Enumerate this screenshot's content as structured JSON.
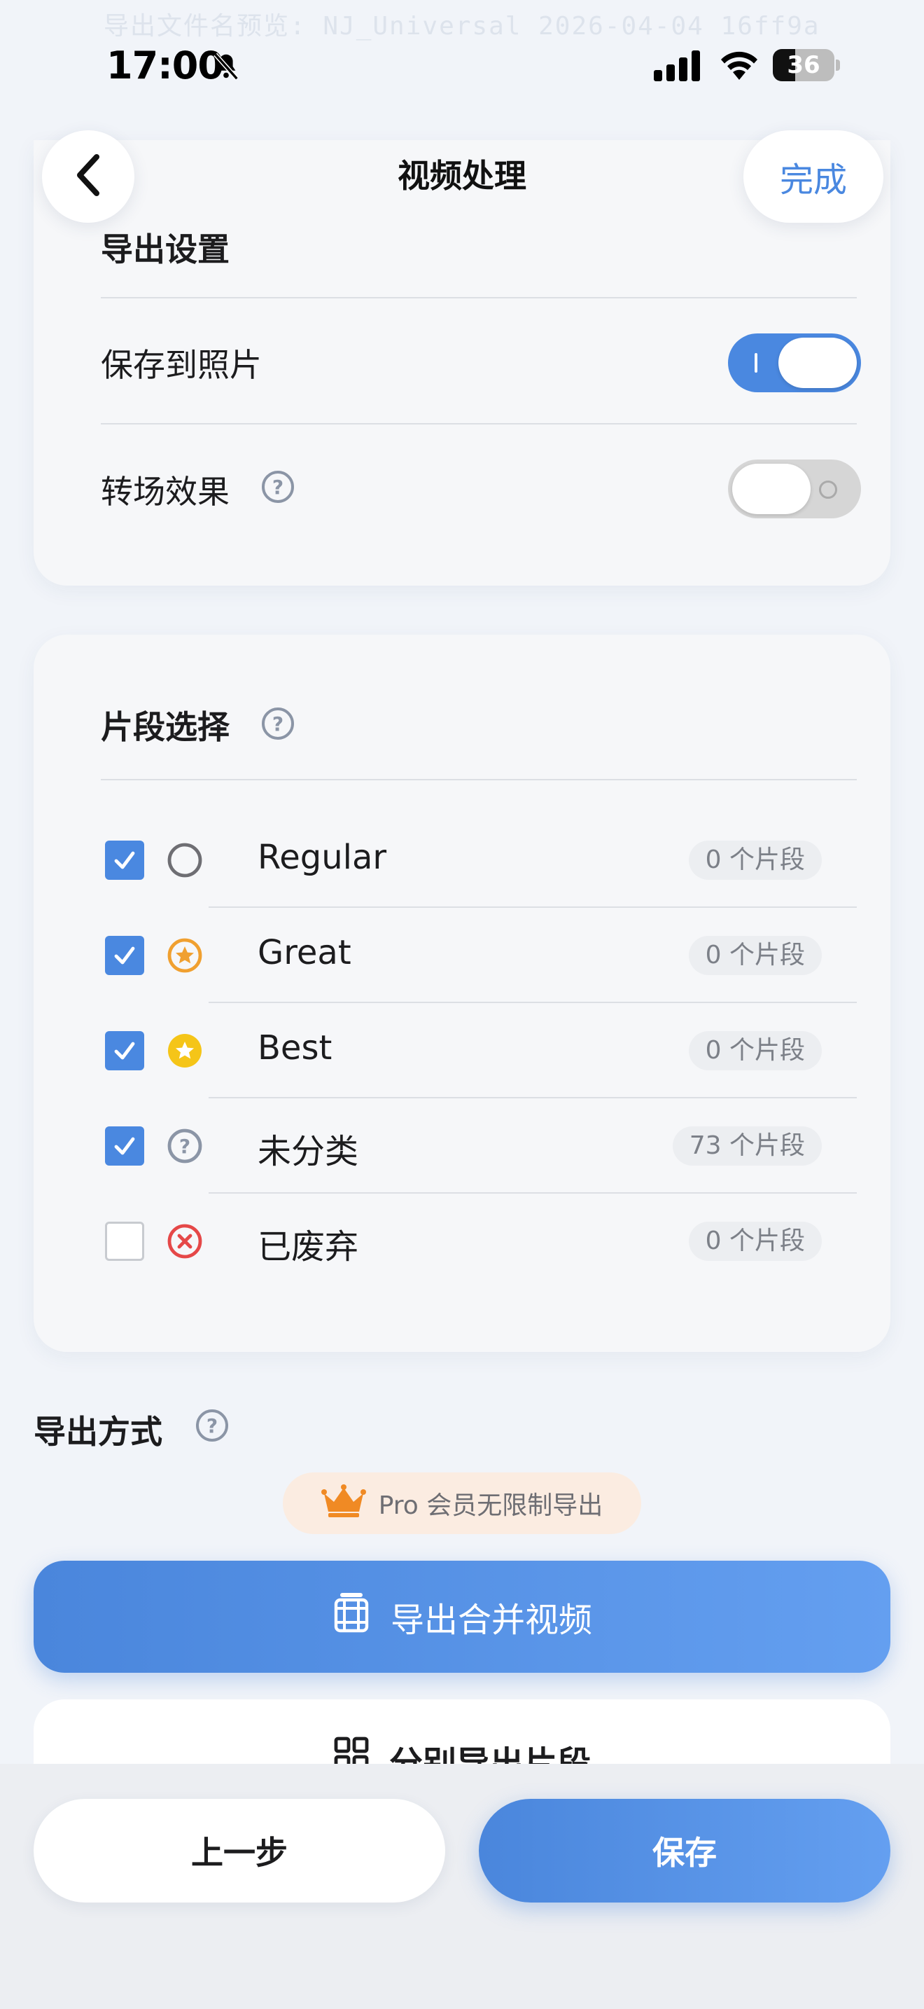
{
  "background_text": "导出文件名预览: NJ_Universal 2026-04-04 16ff9a",
  "status_bar": {
    "time": "17:00",
    "battery_level": "36",
    "battery_fraction": 0.36,
    "icons": [
      "bell-slash-icon",
      "cellular-signal-icon",
      "wifi-icon",
      "battery-icon"
    ]
  },
  "nav": {
    "back_icon": "chevron-left-icon",
    "title": "视频处理",
    "done_label": "完成"
  },
  "export_settings": {
    "title": "导出设置",
    "save_to_photos": {
      "label": "保存到照片",
      "enabled": true
    },
    "transition": {
      "label": "转场效果",
      "enabled": false
    }
  },
  "clip_selection": {
    "title": "片段选择",
    "items": [
      {
        "label": "Regular",
        "count": "0 个片段",
        "checked": true,
        "icon": "empty-circle-icon"
      },
      {
        "label": "Great",
        "count": "0 个片段",
        "checked": true,
        "icon": "star-outline-circle-icon"
      },
      {
        "label": "Best",
        "count": "0 个片段",
        "checked": true,
        "icon": "star-filled-circle-icon"
      },
      {
        "label": "未分类",
        "count": "73 个片段",
        "checked": true,
        "icon": "question-circle-icon"
      },
      {
        "label": "已废弃",
        "count": "0 个片段",
        "checked": false,
        "icon": "x-circle-icon"
      }
    ]
  },
  "export_method": {
    "title": "导出方式",
    "pro_badge": "Pro 会员无限制导出",
    "merge_button": "导出合并视频",
    "separate_button": "分别导出片段"
  },
  "footer": {
    "prev_label": "上一步",
    "save_label": "保存"
  },
  "colors": {
    "accent": "#4a88e0",
    "great_orange": "#f0a030",
    "best_yellow": "#f5c518",
    "discard_red": "#e54848",
    "crown_orange": "#f08a24"
  }
}
